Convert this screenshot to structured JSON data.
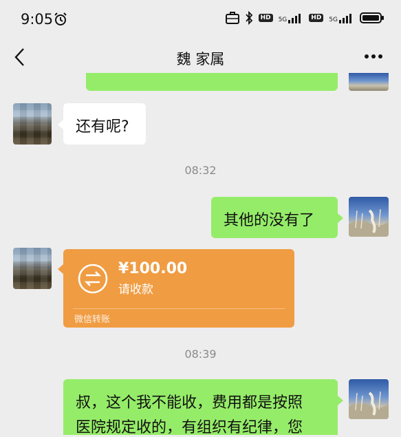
{
  "status_bar": {
    "time": "9:05",
    "hd_1": "HD",
    "net_1": "5G",
    "hd_2": "HD",
    "net_2": "5G"
  },
  "header": {
    "title": "魏    家属"
  },
  "messages": [
    {
      "type": "text",
      "from": "contact",
      "text": "还有呢?"
    },
    {
      "type": "time",
      "text": "08:32"
    },
    {
      "type": "text",
      "from": "self",
      "text": "其他的没有了"
    },
    {
      "type": "transfer",
      "from": "contact",
      "amount": "¥100.00",
      "status": "请收款",
      "footer": "微信转账"
    },
    {
      "type": "time",
      "text": "08:39"
    },
    {
      "type": "text",
      "from": "self",
      "line1": "叔，这个我不能收，费用都是按照",
      "line2": "医院规定收的，有组织有纪律，您"
    }
  ],
  "icons": {
    "back": "back-chevron-icon",
    "more": "more-dots-icon",
    "transfer": "transfer-arrows-icon",
    "alarm": "alarm-icon",
    "bluetooth": "bluetooth-icon",
    "battery": "battery-icon",
    "signal": "signal-icon",
    "briefcase": "work-profile-icon"
  },
  "colors": {
    "background": "#ededed",
    "self_bubble": "#95ec69",
    "contact_bubble": "#ffffff",
    "transfer_card": "#f09c42"
  }
}
